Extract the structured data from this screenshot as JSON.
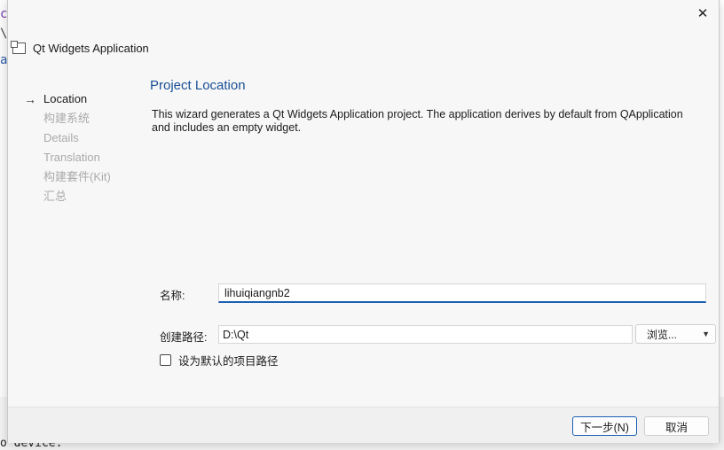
{
  "background": {
    "fragment_1": "c",
    "fragment_2": "\\",
    "fragment_3": "a",
    "bottom_text": "o device."
  },
  "window": {
    "close_glyph": "✕",
    "header_title": "Qt Widgets Application"
  },
  "steps": [
    {
      "label": "Location",
      "active": true
    },
    {
      "label": "构建系统",
      "active": false
    },
    {
      "label": "Details",
      "active": false
    },
    {
      "label": "Translation",
      "active": false
    },
    {
      "label": "构建套件(Kit)",
      "active": false
    },
    {
      "label": "汇总",
      "active": false
    }
  ],
  "steps_arrow": "→",
  "page": {
    "title": "Project Location",
    "description": "This wizard generates a Qt Widgets Application project. The application derives by default from QApplication and includes an empty widget."
  },
  "form": {
    "name_label": "名称:",
    "name_value": "lihuiqiangnb2",
    "path_label": "创建路径:",
    "path_value": "D:\\Qt",
    "browse_label": "浏览...",
    "default_path_label": "设为默认的项目路径",
    "default_path_checked": false
  },
  "footer": {
    "next_label": "下一步(N)",
    "cancel_label": "取消"
  },
  "colors": {
    "accent": "#1a5fb4",
    "title_blue": "#1a4f95",
    "disabled_text": "#aaaaaa"
  }
}
